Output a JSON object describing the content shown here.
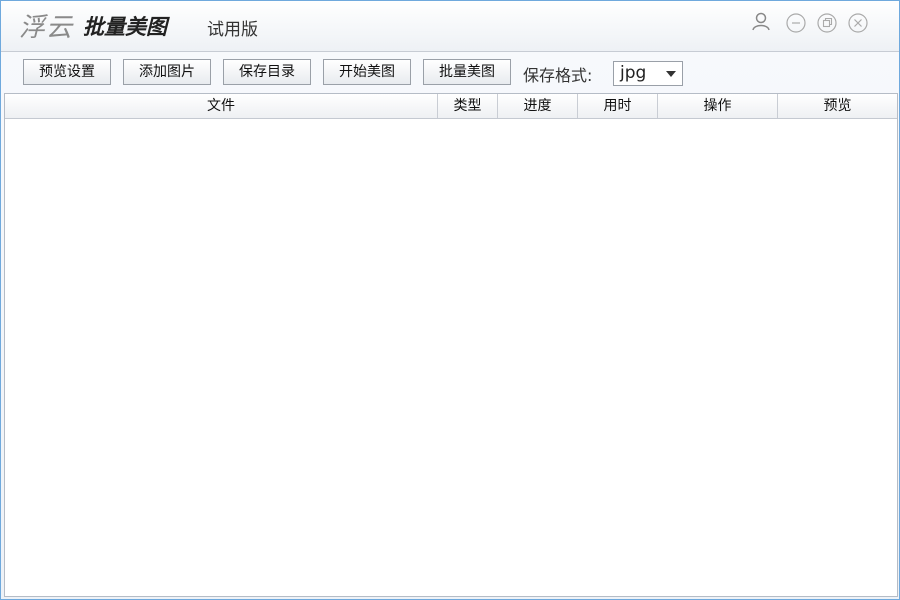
{
  "title": {
    "brand": "浮云",
    "product": "批量美图",
    "edition": "试用版"
  },
  "window_controls": {
    "user": "user-icon",
    "minimize": "minimize-icon",
    "restore": "restore-icon",
    "close": "close-icon"
  },
  "toolbar": {
    "preview_settings": "预览设置",
    "add_images": "添加图片",
    "save_dir": "保存目录",
    "start": "开始美图",
    "batch": "批量美图",
    "format_label": "保存格式:",
    "format_value": "jpg"
  },
  "table": {
    "columns": [
      "文件",
      "类型",
      "进度",
      "用时",
      "操作",
      "预览"
    ]
  },
  "colors": {
    "window_border": "#6fa9dd",
    "header_bg": "#eef0f3"
  }
}
